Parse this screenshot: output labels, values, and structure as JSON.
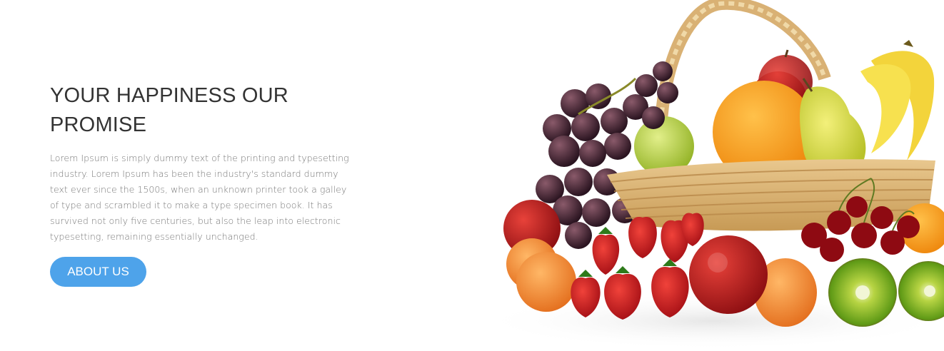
{
  "hero": {
    "title": "YOUR HAPPINESS OUR PROMISE",
    "description": "Lorem Ipsum is simply dummy text of the printing and typesetting industry. Lorem Ipsum has been the industry's standard dummy text ever since the 1500s, when an unknown printer took a galley of type and scrambled it to make a type specimen book. It has survived not only five centuries, but also the leap into electronic typesetting, remaining essentially unchanged.",
    "button_label": "ABOUT US"
  },
  "colors": {
    "button": "#4ea3ea",
    "title": "#333333",
    "body_text": "#777777"
  }
}
